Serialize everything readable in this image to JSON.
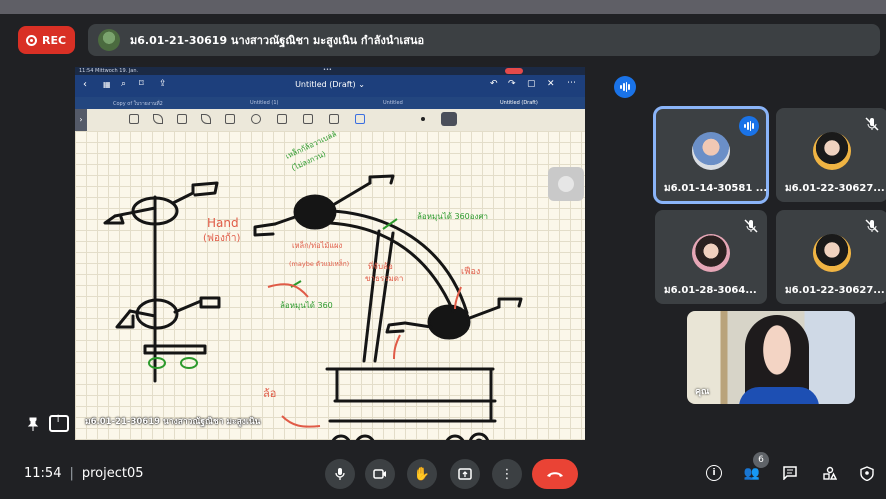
{
  "recording": {
    "label": "REC"
  },
  "presenter": {
    "text": "ม6.01-21-30619 นางสาวณัฐณิชา มะสูงเนิน กำลังนำเสนอ"
  },
  "ipad": {
    "status_left": "11:54  Mittwoch 19. Jan.",
    "status_dots": "•••",
    "doc_title": "Untitled (Draft) ⌄",
    "tabs": [
      "Copy of ใบรายงานที่2",
      "Untitled (1)",
      "Untitled",
      "Untitled (Draft)"
    ]
  },
  "sketch": {
    "labels": {
      "hand_a": "Hand",
      "hand_b": "(ฟองก้า)",
      "top_note_1": "เหล็กกัล้อวาเบลล์",
      "top_note_2": "(ไม่ลงกวน)",
      "mid_note_1": "เหล็ก/ท่อไม้แผง",
      "mid_note_2": "(maybe ตัวแม่เหล็ก)",
      "green_right": "ล้อหมุนได้ 360องศา",
      "green_left": "ล้อหมุนได้ 360",
      "red_mid_1": "ที่จับล้อ",
      "red_mid_2": "ขาธรรมดา",
      "red_right": "เฟือง",
      "red_bottom": "ล้อ"
    }
  },
  "share_name": "ม6.01-21-30619 นางสาวณัฐณิชา มะสูงเนิน",
  "participants": [
    {
      "name": "ม6.01-14-30581 ...",
      "state": "speaking"
    },
    {
      "name": "ม6.01-22-30627...",
      "state": "muted"
    },
    {
      "name": "ม6.01-28-3064...",
      "state": "muted"
    },
    {
      "name": "ม6.01-22-30627...",
      "state": "muted"
    }
  ],
  "self_name": "คุณ",
  "footer": {
    "time": "11:54",
    "meeting_name": "project05",
    "people_count": "6"
  },
  "colors": {
    "accent": "#1a73e8",
    "rec": "#d93025",
    "end_call": "#ea4335",
    "tile_bg": "#3c4043",
    "page_bg": "#202124"
  }
}
